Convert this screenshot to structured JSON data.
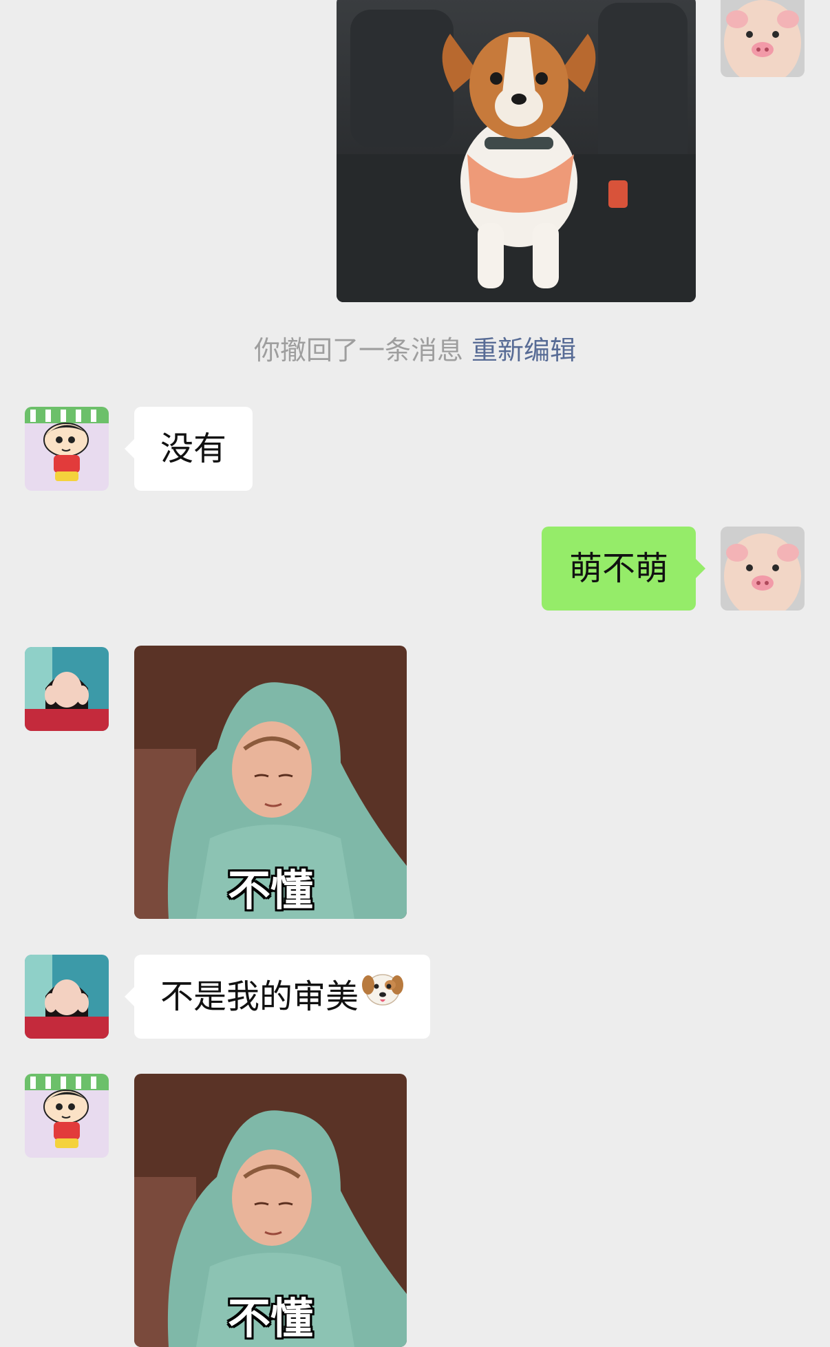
{
  "recall_notice": {
    "text": "你撤回了一条消息",
    "action": "重新编辑"
  },
  "messages": [
    {
      "side": "sent",
      "type": "image",
      "sender": "me",
      "content": "dog photo"
    },
    {
      "side": "received",
      "type": "text",
      "sender": "shinchan",
      "text": "没有"
    },
    {
      "side": "sent",
      "type": "text",
      "sender": "me",
      "text": "萌不萌"
    },
    {
      "side": "received",
      "type": "sticker",
      "sender": "girl",
      "caption": "不懂"
    },
    {
      "side": "received",
      "type": "text",
      "sender": "girl",
      "text": "不是我的审美",
      "emoji": "dog-face"
    },
    {
      "side": "received",
      "type": "sticker",
      "sender": "shinchan",
      "caption": "不懂"
    }
  ],
  "colors": {
    "background": "#ededed",
    "sent_bubble": "#95ec69",
    "received_bubble": "#ffffff",
    "notice_text": "#9e9e9e",
    "link": "#576b95"
  }
}
